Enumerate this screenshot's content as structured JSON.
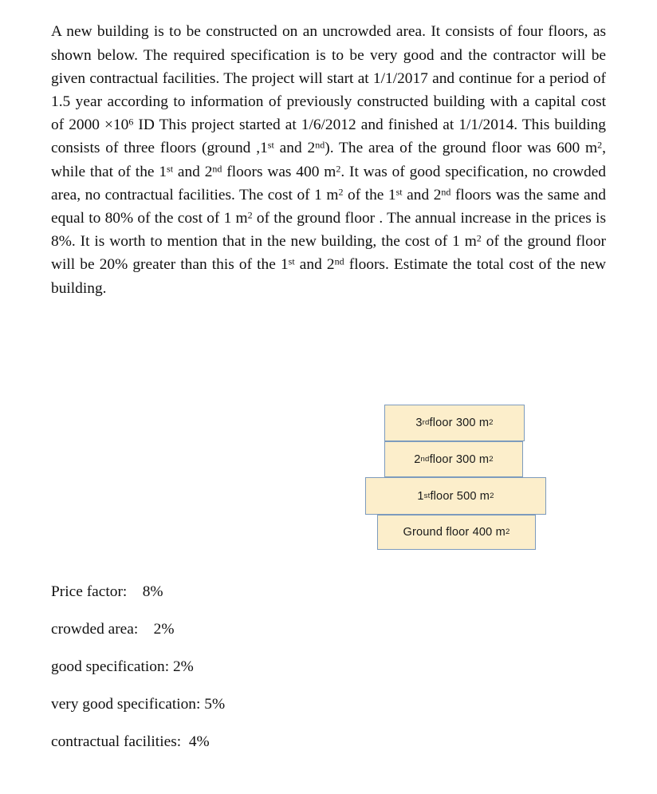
{
  "document": {
    "problem_statement": {
      "segments": [
        {
          "type": "text",
          "value": "A new building is to be constructed on an uncrowded area. It consists of four floors, as shown below. The required specification is to be very good and the contractor will be given contractual facilities. The project will start at 1/1/2017 and continue for a period of 1.5 year according to information of previously constructed building with a capital cost of 2000 ×10"
        },
        {
          "type": "sup",
          "value": "6"
        },
        {
          "type": "text",
          "value": " ID This project started at 1/6/2012 and finished at 1/1/2014. This building consists of three floors (ground ,1"
        },
        {
          "type": "sup",
          "value": "st"
        },
        {
          "type": "text",
          "value": " and 2"
        },
        {
          "type": "sup",
          "value": "nd"
        },
        {
          "type": "text",
          "value": "). The area of the ground floor was 600 m"
        },
        {
          "type": "sup",
          "value": "2"
        },
        {
          "type": "text",
          "value": ", while that of the 1"
        },
        {
          "type": "sup",
          "value": "st"
        },
        {
          "type": "text",
          "value": " and 2"
        },
        {
          "type": "sup",
          "value": "nd"
        },
        {
          "type": "text",
          "value": " floors was 400 m"
        },
        {
          "type": "sup",
          "value": "2"
        },
        {
          "type": "text",
          "value": ". It was of good specification, no crowded area, no contractual facilities. The cost of 1 m"
        },
        {
          "type": "sup",
          "value": "2"
        },
        {
          "type": "text",
          "value": " of the 1"
        },
        {
          "type": "sup",
          "value": "st"
        },
        {
          "type": "text",
          "value": " and 2"
        },
        {
          "type": "sup",
          "value": "nd"
        },
        {
          "type": "text",
          "value": " floors was the same and equal to 80% of the cost of 1 m"
        },
        {
          "type": "sup",
          "value": "2"
        },
        {
          "type": "text",
          "value": " of the ground floor . The annual increase in the prices is 8%. It is worth to mention that in the new building, the cost of 1 m"
        },
        {
          "type": "sup",
          "value": "2"
        },
        {
          "type": "text",
          "value": " of the ground floor will be 20% greater than this of the 1"
        },
        {
          "type": "sup",
          "value": "st"
        },
        {
          "type": "text",
          "value": " and 2"
        },
        {
          "type": "sup",
          "value": "nd"
        },
        {
          "type": "text",
          "value": " floors. Estimate the total cost of the new building."
        }
      ]
    },
    "building_diagram": {
      "fill_color": "#fceecb",
      "border_color": "#7d9bbd",
      "floors": [
        {
          "id": "third-floor",
          "ordinal": "3",
          "ordinal_suffix": "rd",
          "label_mid": " floor 300 m",
          "area_unit_sup": "2"
        },
        {
          "id": "second-floor",
          "ordinal": "2",
          "ordinal_suffix": "nd",
          "label_mid": " floor 300 m",
          "area_unit_sup": "2"
        },
        {
          "id": "first-floor",
          "ordinal": "1",
          "ordinal_suffix": "st",
          "label_mid": " floor 500 m",
          "area_unit_sup": "2"
        },
        {
          "id": "ground-floor",
          "ordinal": "",
          "ordinal_suffix": "",
          "label_mid": "Ground floor 400 m",
          "area_unit_sup": "2"
        }
      ]
    },
    "factors": [
      {
        "label": "Price factor:",
        "gap": "    ",
        "value": "8%"
      },
      {
        "label": "crowded area:",
        "gap": "    ",
        "value": "2%"
      },
      {
        "label": "good specification:",
        "gap": " ",
        "value": "2%"
      },
      {
        "label": "very good specification:",
        "gap": " ",
        "value": "5%"
      },
      {
        "label": "contractual facilities:",
        "gap": "  ",
        "value": "4%"
      }
    ]
  }
}
